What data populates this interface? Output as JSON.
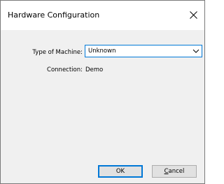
{
  "window": {
    "title": "Hardware Configuration",
    "close_icon": "close-icon"
  },
  "form": {
    "machine_label": "Type of Machine:",
    "machine_value": "Unknown",
    "dropdown_icon": "chevron-down-icon",
    "connection_label": "Connection:",
    "connection_value": "Demo"
  },
  "buttons": {
    "ok_label": "OK",
    "cancel_first": "C",
    "cancel_rest": "ancel"
  },
  "colors": {
    "accent": "#0078d7",
    "dialog_bg": "#f0f0f0",
    "title_bg": "#ffffff",
    "button_bg": "#e1e1e1"
  }
}
